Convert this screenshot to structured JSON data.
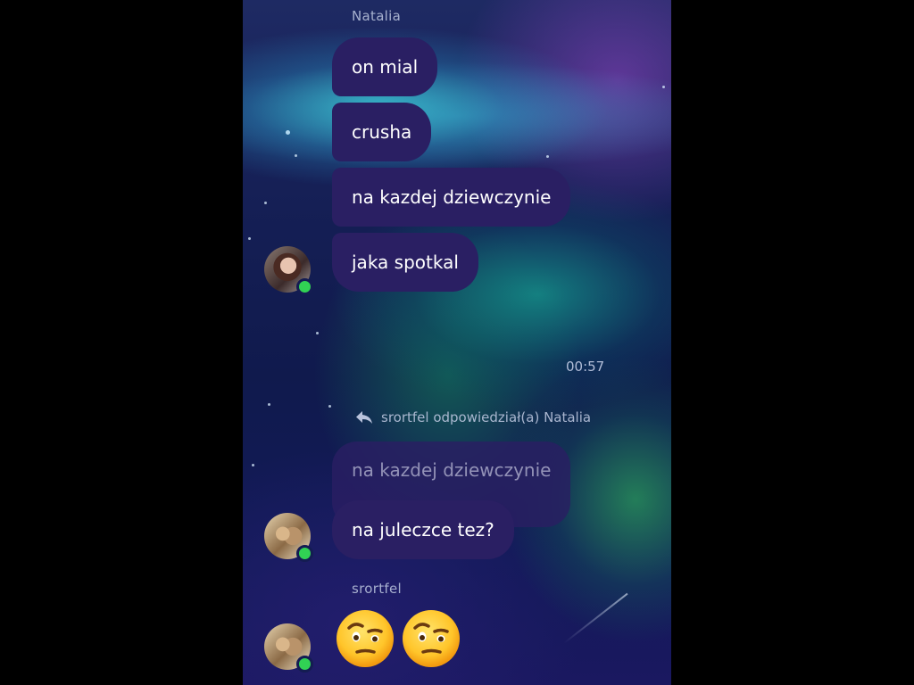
{
  "conversation": {
    "first_group": {
      "sender": "Natalia",
      "messages": [
        "on mial",
        "crusha",
        "na kazdej dziewczynie",
        "jaka spotkal"
      ]
    },
    "timestamp": "00:57",
    "reply_info": "srortfel odpowiedział(a) Natalia",
    "quoted_message": "na kazdej dziewczynie",
    "reply_message": "na juleczce tez?",
    "last_group": {
      "sender": "srortfel",
      "emojis": [
        "face-with-raised-eyebrow",
        "face-with-raised-eyebrow"
      ]
    }
  },
  "icons": {
    "reply": "reply-arrow-icon",
    "online": "online-status-icon"
  },
  "colors": {
    "bubble": "#2a1f63",
    "online": "#31d254"
  }
}
